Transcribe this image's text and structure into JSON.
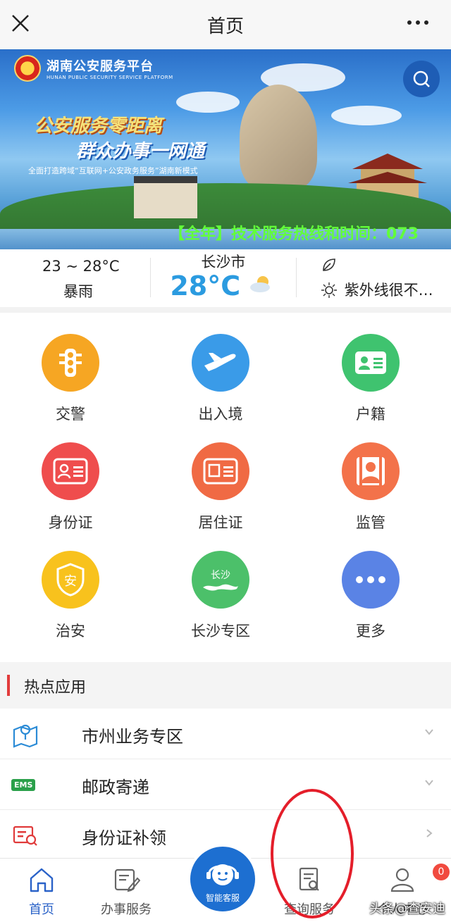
{
  "topbar": {
    "title": "首页",
    "close_icon": "close-icon",
    "more_icon": "more-icon"
  },
  "banner": {
    "brand_cn": "湖南公安服务平台",
    "brand_en": "HUNAN PUBLIC SECURITY SERVICE PLATFORM",
    "slogan_line1": "公安服务零距离",
    "slogan_line2": "群众办事一网通",
    "slogan_line3": "全面打造跨域“互联网+公安政务服务”湖南新模式",
    "ticker": "【全年】技术服务热线和时间：073"
  },
  "weather": {
    "range": "23 ~ 28°C",
    "condition": "暴雨",
    "city": "长沙市",
    "temp": "28°C",
    "uv": "紫外线很不…"
  },
  "apps": [
    {
      "label": "交警",
      "color": "#f6a623"
    },
    {
      "label": "出入境",
      "color": "#3a9be8"
    },
    {
      "label": "户籍",
      "color": "#3fc36f"
    },
    {
      "label": "身份证",
      "color": "#ef4d4d"
    },
    {
      "label": "居住证",
      "color": "#f06a44"
    },
    {
      "label": "监管",
      "color": "#f3724a"
    },
    {
      "label": "治安",
      "color": "#f8c21d"
    },
    {
      "label": "长沙专区",
      "color": "#4cc06a"
    },
    {
      "label": "更多",
      "color": "#5a83e5"
    }
  ],
  "changsha_badge": "长沙",
  "section": {
    "title": "热点应用"
  },
  "list": [
    {
      "label": "市州业务专区"
    },
    {
      "label": "邮政寄递"
    },
    {
      "label": "身份证补领"
    }
  ],
  "ems_text": "EMS",
  "tabs": {
    "home": "首页",
    "services": "办事服务",
    "assistant": "智能客服",
    "query": "查询服务",
    "profile": "个人中心",
    "badge": "0"
  },
  "watermark": "头条@查安迪",
  "colors": {
    "accent": "#2a62c8",
    "annotation": "#e41e2a"
  }
}
